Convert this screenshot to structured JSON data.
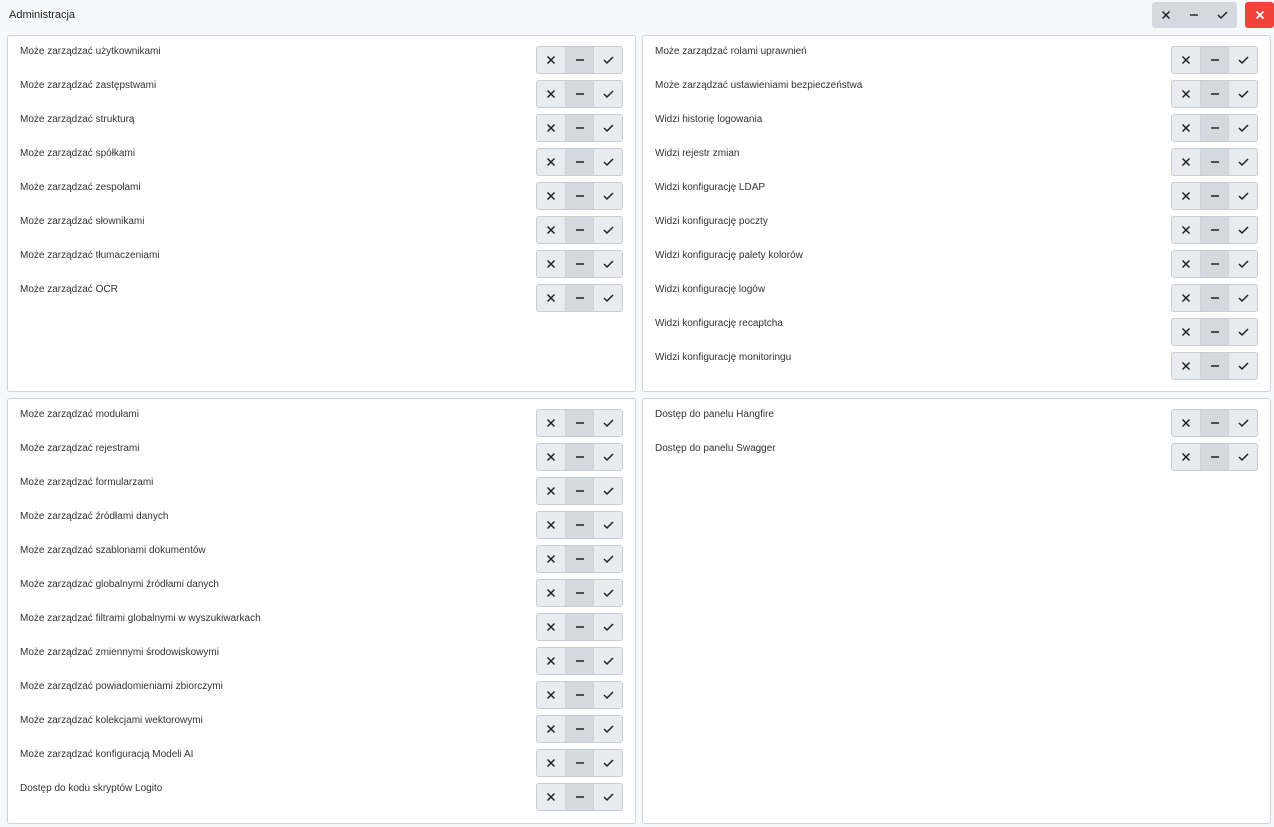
{
  "window": {
    "title": "Administracja",
    "global_controls": {
      "deny": "✕",
      "neutral": "—",
      "allow": "✓"
    },
    "close_label": "✕",
    "close_color": "#f0433a"
  },
  "panels": [
    {
      "items": [
        "Może zarządzać użytkownikami",
        "Może zarządzać zastępstwami",
        "Może zarządzać strukturą",
        "Może zarządzać spółkami",
        "Może zarządzać zespołami",
        "Może zarządzać słownikami",
        "Może zarządzać tłumaczeniami",
        "Może zarządzać OCR"
      ]
    },
    {
      "items": [
        "Może zarządzać rolami uprawnień",
        "Może zarządzać ustawieniami bezpieczeństwa",
        "Widzi historię logowania",
        "Widzi rejestr zmian",
        "Widzi konfigurację LDAP",
        "Widzi konfigurację poczty",
        "Widzi konfigurację palety kolorów",
        "Widzi konfigurację logów",
        "Widzi konfigurację recaptcha",
        "Widzi konfigurację monitoringu"
      ]
    },
    {
      "items": [
        "Może zarządzać modułami",
        "Może zarządzać rejestrami",
        "Może zarządzać formularzami",
        "Może zarządzać źródłami danych",
        "Może zarządzać szablonami dokumentów",
        "Może zarządzać globalnymi źródłami danych",
        "Może zarządzać filtrami globalnymi w wyszukiwarkach",
        "Może zarządzać zmiennymi środowiskowymi",
        "Może zarządzać powiadomieniami zbiorczymi",
        "Może zarządzać kolekcjami wektorowymi",
        "Może zarządzać konfiguracją Modeli AI",
        "Dostęp do kodu skryptów Logito"
      ]
    },
    {
      "items": [
        "Dostęp do panelu Hangfire",
        "Dostęp do panelu Swagger"
      ]
    }
  ],
  "selected_state": "neutral"
}
